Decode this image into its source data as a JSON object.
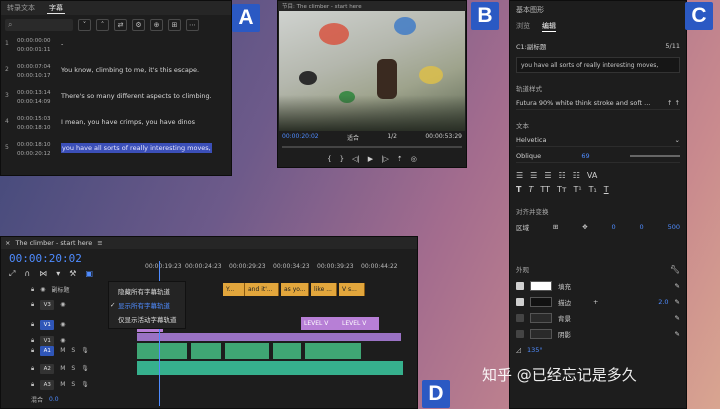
{
  "labels": {
    "a": "A",
    "b": "B",
    "c": "C",
    "d": "D"
  },
  "captions_panel": {
    "tabs": [
      "转录文本",
      "字幕"
    ],
    "search_placeholder": "",
    "rows": [
      {
        "num": "1",
        "in": "00:00:00:00",
        "out": "00:00:01:11",
        "text": "-"
      },
      {
        "num": "2",
        "in": "00:00:07:04",
        "out": "00:00:10:17",
        "text": "You know, climbing to me, it's this escape."
      },
      {
        "num": "3",
        "in": "00:00:13:14",
        "out": "00:00:14:09",
        "text": "There's so many different aspects to climbing."
      },
      {
        "num": "4",
        "in": "00:00:15:03",
        "out": "00:00:18:10",
        "text": "I mean, you have crimps, you have dinos"
      },
      {
        "num": "5",
        "in": "00:00:18:10",
        "out": "00:00:20:12",
        "text": "you have all sorts of really interesting moves,"
      }
    ]
  },
  "program_panel": {
    "title": "节目: The climber - start here",
    "timecode_current": "00:00:20:02",
    "timecode_total": "00:00:53:29",
    "fit": "适合",
    "fraction": "1/2"
  },
  "graphics_panel": {
    "title": "基本图形",
    "tabs": [
      "浏览",
      "编辑"
    ],
    "layer_name": "C1:副标题",
    "layer_count": "5/11",
    "caption_text": "you have all sorts of really interesting moves,",
    "track_style_label": "轨道样式",
    "track_style_value": "Futura 90% white think stroke and soft ...",
    "text_label": "文本",
    "font": "Helvetica",
    "font_style": "Oblique",
    "font_size": "69",
    "align_label": "对齐并变换",
    "region_label": "区域",
    "pos_x": "0",
    "pos_y": "0",
    "width": "500",
    "appearance_label": "外观",
    "appearance": [
      {
        "name": "填充",
        "on": true,
        "color": "#ffffff"
      },
      {
        "name": "描边",
        "on": true,
        "color": "#111111",
        "value": "2.0"
      },
      {
        "name": "背景",
        "on": false,
        "color": "#2a2a2a"
      },
      {
        "name": "阴影",
        "on": false,
        "color": "#2a2a2a"
      }
    ],
    "angle": "135°"
  },
  "timeline_panel": {
    "sequence_name": "The climber - start here",
    "timecode": "00:00:20:02",
    "ruler": [
      "00:00:19:23",
      "00:00:24:23",
      "00:00:29:23",
      "00:00:34:23",
      "00:00:39:23",
      "00:00:44:22"
    ],
    "tracks": [
      "V1",
      "V1",
      "A1",
      "A2",
      "A3"
    ],
    "v3_label": "V3",
    "sub_label": "副标题",
    "mix_label": "混合",
    "mix_value": "0.0",
    "caption_clips": [
      "Y...",
      "and it'...",
      "as yo...",
      "like ...",
      "V s..."
    ],
    "video_clips": [
      "LEVEL V",
      "LEVEL V"
    ],
    "menu": [
      {
        "label": "隐藏所有字幕轨道",
        "checked": false
      },
      {
        "label": "显示所有字幕轨道",
        "checked": true
      },
      {
        "label": "仅显示活动字幕轨道",
        "checked": false
      }
    ]
  },
  "watermark": "知乎 @已经忘记是多久",
  "colors": {
    "accent": "#4f8cff",
    "label_blue": "#2b59c3",
    "caption_clip": "#e2a63c",
    "video_clip": "#b77fd6",
    "audio_clip": "#3fa674"
  }
}
